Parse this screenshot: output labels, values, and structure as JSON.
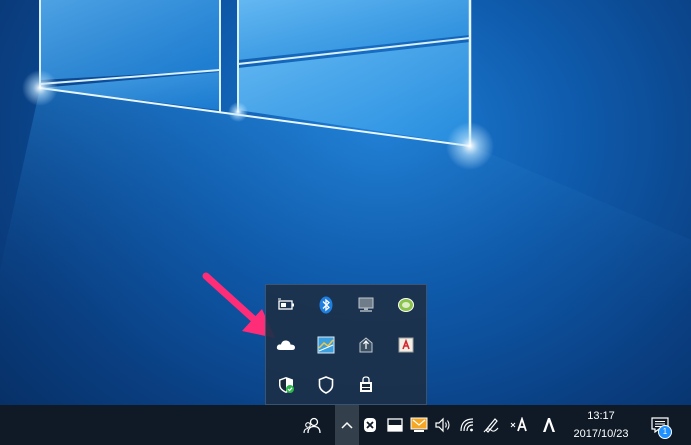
{
  "clock": {
    "time": "13:17",
    "date": "2017/10/23"
  },
  "action_center": {
    "badge_count": "1"
  },
  "tray_overflow": {
    "icons": [
      "battery-power-icon",
      "bluetooth-icon",
      "display-settings-icon",
      "green-chat-app-icon",
      "onedrive-cloud-icon",
      "network-map-app-icon",
      "safely-remove-hardware-icon",
      "adobe-updater-icon",
      "windows-defender-icon",
      "shield-security-icon",
      "printer-lock-icon"
    ]
  },
  "taskbar": {
    "tray_icons": [
      "people-icon",
      "show-hidden-icons-chevron",
      "xbox-icon",
      "touch-keyboard-icon",
      "notification-app-icon",
      "volume-icon",
      "wifi-icon",
      "pen-workspace-icon",
      "ime-mode-icon",
      "adobe-creative-cloud-icon",
      "action-center-icon"
    ],
    "ime_label": "A"
  },
  "colors": {
    "arrow": "#ff2d78",
    "taskbar": "#0f1a26",
    "tray_popup": "#1c3048",
    "accent_blue": "#1e90ff"
  }
}
